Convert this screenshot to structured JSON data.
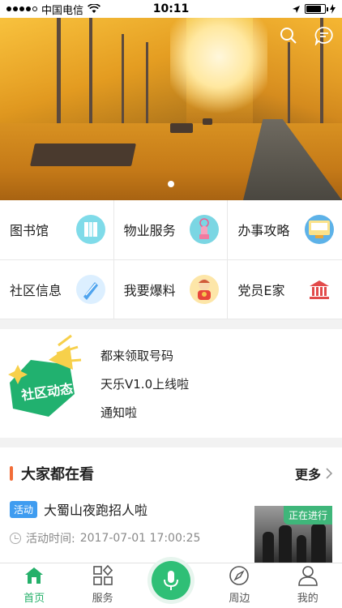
{
  "status_bar": {
    "carrier": "中国电信",
    "time": "10:11"
  },
  "banner": {
    "search_icon": "search-icon",
    "message_icon": "message-icon",
    "slide_count": 1,
    "active_slide": 1
  },
  "services": [
    {
      "label": "图书馆",
      "icon": "library-icon",
      "color": "#6fd4e6"
    },
    {
      "label": "物业服务",
      "icon": "property-service-icon",
      "color": "#f2a9c4"
    },
    {
      "label": "办事攻略",
      "icon": "guide-icon",
      "color": "#5db2e8"
    },
    {
      "label": "社区信息",
      "icon": "community-info-icon",
      "color": "#77b8ef"
    },
    {
      "label": "我要爆料",
      "icon": "report-icon",
      "color": "#f6c54c"
    },
    {
      "label": "党员E家",
      "icon": "party-home-icon",
      "color": "#e24b4b"
    }
  ],
  "community_news": {
    "badge_text": "社区动态",
    "items": [
      "都来领取号码",
      "天乐V1.0上线啦",
      "通知啦"
    ]
  },
  "popular": {
    "title": "大家都在看",
    "more_label": "更多",
    "accent_color": "#f26d38",
    "items": [
      {
        "tag": "活动",
        "title": "大蜀山夜跑招人啦",
        "time_label": "活动时间:",
        "time_value": "2017-07-01 17:00:25",
        "status": "正在进行"
      }
    ]
  },
  "tab_bar": {
    "tabs": [
      {
        "label": "首页",
        "icon": "home-icon",
        "active": true
      },
      {
        "label": "服务",
        "icon": "services-icon",
        "active": false
      },
      {
        "label": "周边",
        "icon": "compass-icon",
        "active": false
      },
      {
        "label": "我的",
        "icon": "profile-icon",
        "active": false
      }
    ],
    "center_icon": "microphone-icon",
    "active_color": "#25b06a"
  }
}
